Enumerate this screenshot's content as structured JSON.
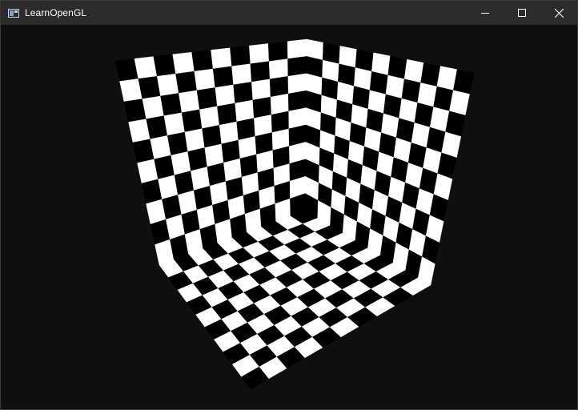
{
  "window": {
    "title": "LearnOpenGL",
    "app_icon": "window-app-icon",
    "controls": [
      "minimize-icon",
      "maximize-icon",
      "close-icon"
    ]
  },
  "scene": {
    "description_colors": {
      "background": "#0f0f0f",
      "checker_light": "#ffffff",
      "checker_dark": "#000000"
    },
    "faces": [
      "left-wall",
      "right-wall",
      "floor"
    ],
    "grid": 10
  }
}
